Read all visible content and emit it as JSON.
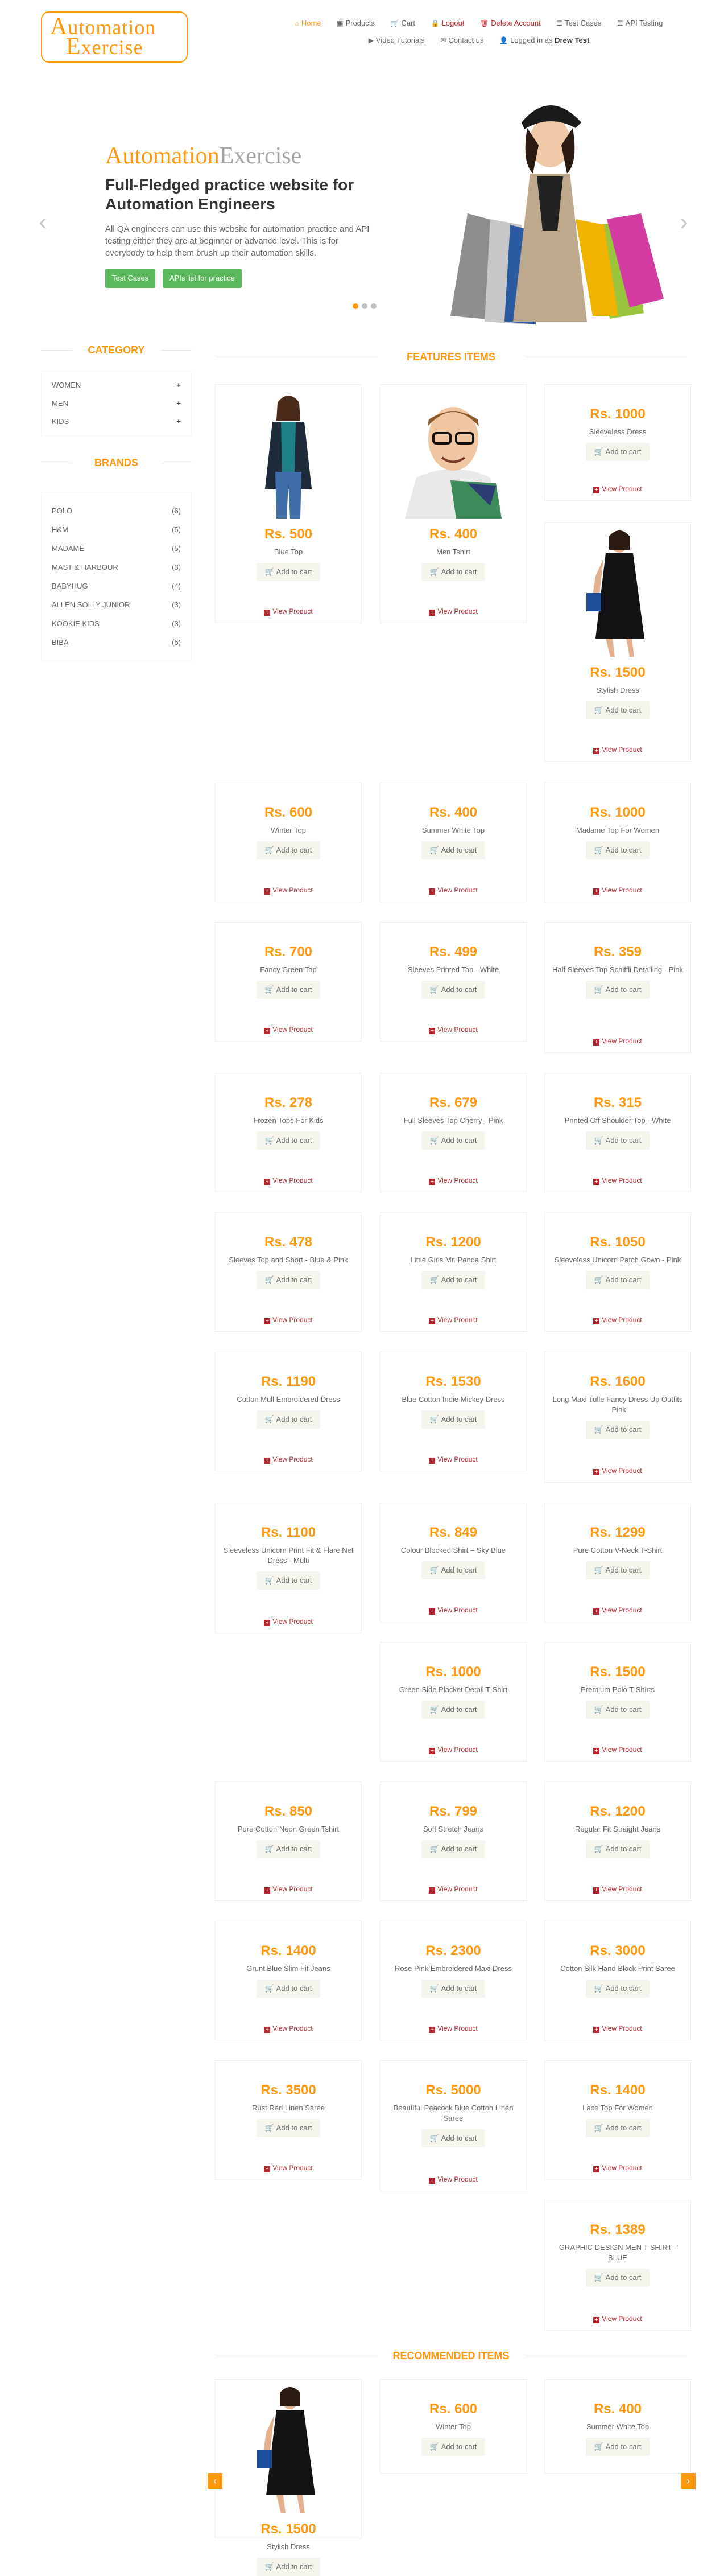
{
  "logo": {
    "line1_cap": "A",
    "line1_rest": "utomation",
    "line2_cap": "E",
    "line2_rest": "xercise"
  },
  "nav": {
    "home": "Home",
    "products": "Products",
    "cart": "Cart",
    "logout": "Logout",
    "delete": "Delete Account",
    "test_cases": "Test Cases",
    "api_testing": "API Testing",
    "video": "Video Tutorials",
    "contact": "Contact us",
    "logged_prefix": "Logged in as",
    "user": "Drew Test"
  },
  "slider": {
    "brand_a": "Automation",
    "brand_b": "Exercise",
    "heading": "Full-Fledged practice website for Automation Engineers",
    "text": "All QA engineers can use this website for automation practice and API testing either they are at beginner or advance level. This is for everybody to help them brush up their automation skills.",
    "btn_test_cases": "Test Cases",
    "btn_api": "APIs list for practice",
    "prev": "‹",
    "next": "›"
  },
  "sidebar": {
    "category_title": "CATEGORY",
    "categories": [
      "WOMEN",
      "MEN",
      "KIDS"
    ],
    "brands_title": "BRANDS",
    "brands": [
      {
        "name": "POLO",
        "count": "(6)"
      },
      {
        "name": "H&M",
        "count": "(5)"
      },
      {
        "name": "MADAME",
        "count": "(5)"
      },
      {
        "name": "MAST & HARBOUR",
        "count": "(3)"
      },
      {
        "name": "BABYHUG",
        "count": "(4)"
      },
      {
        "name": "ALLEN SOLLY JUNIOR",
        "count": "(3)"
      },
      {
        "name": "KOOKIE KIDS",
        "count": "(3)"
      },
      {
        "name": "BIBA",
        "count": "(5)"
      }
    ]
  },
  "features_title": "FEATURES ITEMS",
  "products": [
    {
      "price": "Rs. 500",
      "name": "Blue Top"
    },
    {
      "price": "Rs. 400",
      "name": "Men Tshirt"
    },
    {
      "price": "Rs. 1000",
      "name": "Sleeveless Dress"
    },
    {
      "price": "Rs. 1500",
      "name": "Stylish Dress"
    },
    {
      "price": "Rs. 600",
      "name": "Winter Top"
    },
    {
      "price": "Rs. 400",
      "name": "Summer White Top"
    },
    {
      "price": "Rs. 1000",
      "name": "Madame Top For Women"
    },
    {
      "price": "Rs. 700",
      "name": "Fancy Green Top"
    },
    {
      "price": "Rs. 499",
      "name": "Sleeves Printed Top - White"
    },
    {
      "price": "Rs. 359",
      "name": "Half Sleeves Top Schiffli Detailing - Pink"
    },
    {
      "price": "Rs. 278",
      "name": "Frozen Tops For Kids"
    },
    {
      "price": "Rs. 679",
      "name": "Full Sleeves Top Cherry - Pink"
    },
    {
      "price": "Rs. 315",
      "name": "Printed Off Shoulder Top - White"
    },
    {
      "price": "Rs. 478",
      "name": "Sleeves Top and Short - Blue & Pink"
    },
    {
      "price": "Rs. 1200",
      "name": "Little Girls Mr. Panda Shirt"
    },
    {
      "price": "Rs. 1050",
      "name": "Sleeveless Unicorn Patch Gown - Pink"
    },
    {
      "price": "Rs. 1190",
      "name": "Cotton Mull Embroidered Dress"
    },
    {
      "price": "Rs. 1530",
      "name": "Blue Cotton Indie Mickey Dress"
    },
    {
      "price": "Rs. 1600",
      "name": "Long Maxi Tulle Fancy Dress Up Outfits -Pink"
    },
    {
      "price": "Rs. 1100",
      "name": "Sleeveless Unicorn Print Fit & Flare Net Dress - Multi"
    },
    {
      "price": "Rs. 849",
      "name": "Colour Blocked Shirt – Sky Blue"
    },
    {
      "price": "Rs. 1299",
      "name": "Pure Cotton V-Neck T-Shirt"
    },
    {
      "price": "Rs. 1000",
      "name": "Green Side Placket Detail T-Shirt"
    },
    {
      "price": "Rs. 1500",
      "name": "Premium Polo T-Shirts"
    },
    {
      "price": "Rs. 850",
      "name": "Pure Cotton Neon Green Tshirt"
    },
    {
      "price": "Rs. 799",
      "name": "Soft Stretch Jeans"
    },
    {
      "price": "Rs. 1200",
      "name": "Regular Fit Straight Jeans"
    },
    {
      "price": "Rs. 1400",
      "name": "Grunt Blue Slim Fit Jeans"
    },
    {
      "price": "Rs. 2300",
      "name": "Rose Pink Embroidered Maxi Dress"
    },
    {
      "price": "Rs. 3000",
      "name": "Cotton Silk Hand Block Print Saree"
    },
    {
      "price": "Rs. 3500",
      "name": "Rust Red Linen Saree"
    },
    {
      "price": "Rs. 5000",
      "name": "Beautiful Peacock Blue Cotton Linen Saree"
    },
    {
      "price": "Rs. 1400",
      "name": "Lace Top For Women"
    },
    {
      "price": "Rs. 1389",
      "name": "GRAPHIC DESIGN MEN T SHIRT - BLUE"
    }
  ],
  "recommended_title": "RECOMMENDED ITEMS",
  "recommended": [
    {
      "price": "Rs. 1500",
      "name": "Stylish Dress"
    },
    {
      "price": "Rs. 600",
      "name": "Winter Top"
    },
    {
      "price": "Rs. 400",
      "name": "Summer White Top"
    }
  ],
  "labels": {
    "add_to_cart": "Add to cart",
    "view_product": "View Product",
    "plus": "+",
    "cart_icon": "🛒"
  },
  "icons": {
    "home": "home-icon",
    "products": "products-icon",
    "cart": "cart-icon",
    "logout": "lock-icon",
    "delete": "trash-icon",
    "list": "list-icon",
    "video": "youtube-icon",
    "contact": "envelope-icon",
    "user": "user-icon"
  },
  "colors": {
    "accent": "#fe980f",
    "green": "#5cb85c",
    "view_red": "#b3282e"
  }
}
